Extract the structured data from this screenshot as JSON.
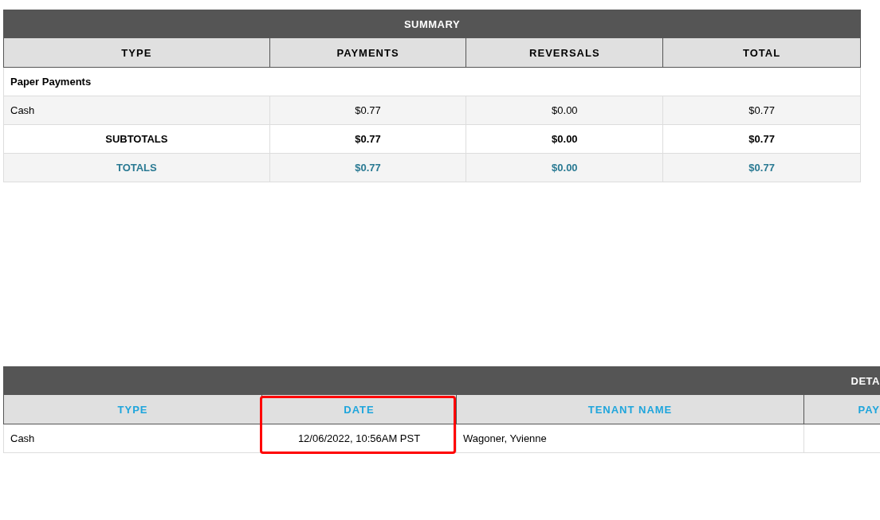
{
  "summary": {
    "title": "SUMMARY",
    "columns": [
      "TYPE",
      "PAYMENTS",
      "REVERSALS",
      "TOTAL"
    ],
    "rows": [
      {
        "kind": "section",
        "cells": [
          "Paper Payments"
        ]
      },
      {
        "kind": "item",
        "cells": [
          "Cash",
          "$0.77",
          "$0.00",
          "$0.77"
        ]
      },
      {
        "kind": "subtotal",
        "cells": [
          "SUBTOTALS",
          "$0.77",
          "$0.00",
          "$0.77"
        ]
      },
      {
        "kind": "total",
        "cells": [
          "TOTALS",
          "$0.77",
          "$0.00",
          "$0.77"
        ]
      }
    ]
  },
  "details": {
    "title": "DETA",
    "columns": [
      {
        "label": "TYPE",
        "highlighted": false
      },
      {
        "label": "DATE",
        "highlighted": true
      },
      {
        "label": "TENANT NAME",
        "highlighted": false
      },
      {
        "label": "PAY",
        "highlighted": false
      }
    ],
    "rows": [
      {
        "cells": [
          "Cash",
          "12/06/2022, 10:56AM PST",
          "Wagoner, Yvienne",
          null
        ]
      }
    ]
  }
}
